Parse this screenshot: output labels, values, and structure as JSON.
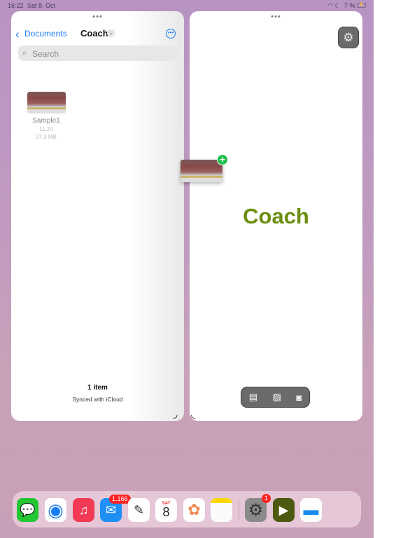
{
  "status_bar": {
    "time": "16:22",
    "date": "Sat 8. Oct",
    "battery": "7 %"
  },
  "files": {
    "back_label": "Documents",
    "title": "Coach",
    "search_placeholder": "Search",
    "items": [
      {
        "name": "Sample1",
        "time": "11:24",
        "size": "37,3 MB"
      }
    ],
    "footer_count": "1 item",
    "footer_status": "Synced with iCloud"
  },
  "coach": {
    "title": "Coach",
    "title_color": "#6b8e10"
  },
  "dock": {
    "apps": [
      {
        "name": "Messages"
      },
      {
        "name": "Safari"
      },
      {
        "name": "Music"
      },
      {
        "name": "Mail",
        "badge": "1.166"
      },
      {
        "name": "Freeform"
      },
      {
        "name": "Calendar",
        "day": "SAT",
        "date": "8"
      },
      {
        "name": "Photos"
      },
      {
        "name": "Notes"
      },
      {
        "name": "Settings",
        "badge": "1"
      },
      {
        "name": "Coach"
      },
      {
        "name": "Files"
      }
    ]
  }
}
